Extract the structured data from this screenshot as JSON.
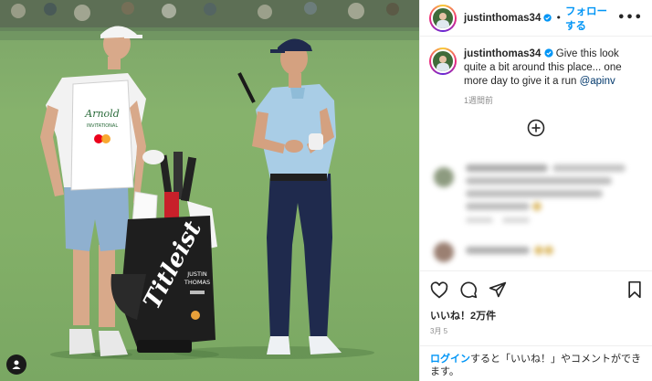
{
  "post": {
    "username": "justinthomas34",
    "follow_label": "フォローする",
    "separator": "•",
    "more_label": "•••",
    "caption_text": "Give this look quite a bit around this place... one more day to give it a run",
    "caption_mention": "@apinv",
    "time_ago": "1週間前",
    "likes": "いいね！2万件",
    "date": "3月 5",
    "login_link": "ログイン",
    "login_text": "すると「いいね！」やコメントができます。"
  },
  "photo": {
    "caddie_bib": "Arnold Palmer INVITATIONAL",
    "bag_brand": "Titleist",
    "bag_name": "JUSTIN THOMAS"
  },
  "colors": {
    "link_blue": "#0095f6",
    "mention_blue": "#00376b",
    "grass": "#83b068"
  },
  "icons": [
    "verified-icon",
    "more-icon",
    "add-comment-icon",
    "heart-icon",
    "comment-icon",
    "share-icon",
    "save-icon",
    "user-icon"
  ]
}
